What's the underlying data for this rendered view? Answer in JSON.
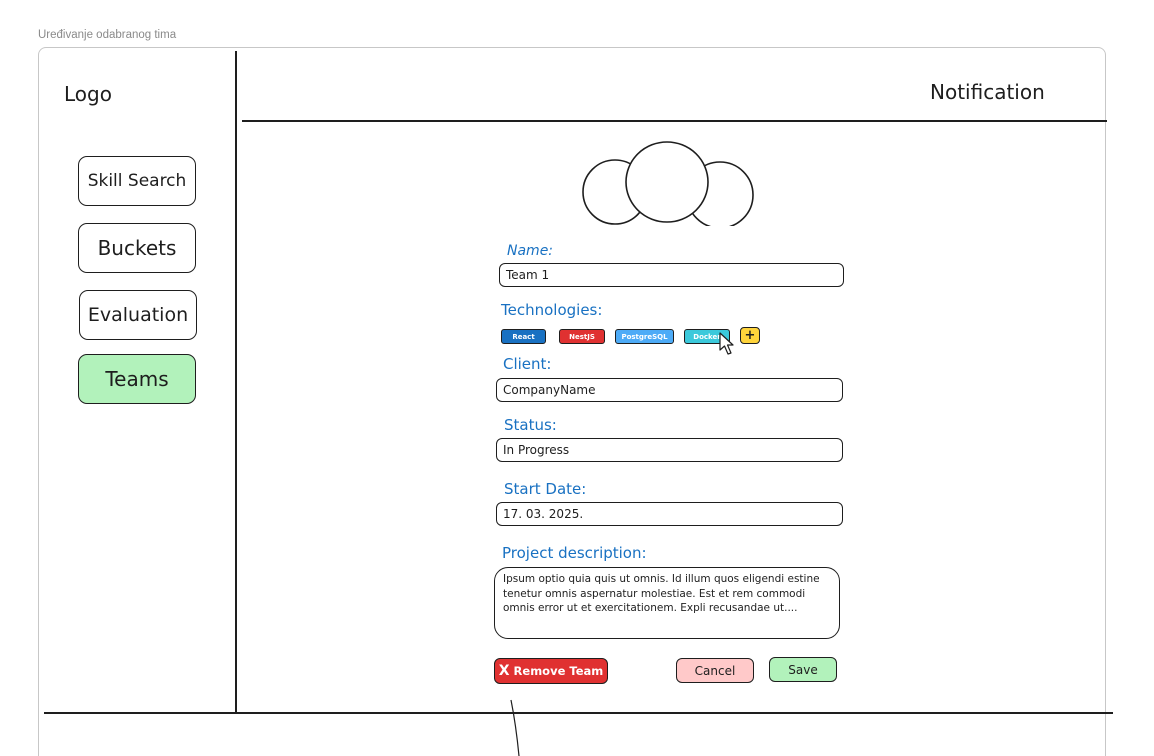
{
  "frame": {
    "title": "Uređivanje odabranog tima"
  },
  "header": {
    "logo": "Logo",
    "notification": "Notification"
  },
  "sidebar": {
    "items": [
      {
        "label": "Skill Search",
        "active": false
      },
      {
        "label": "Buckets",
        "active": false
      },
      {
        "label": "Evaluation",
        "active": false
      },
      {
        "label": "Teams",
        "active": true
      }
    ]
  },
  "form": {
    "name": {
      "label": "Name:",
      "value": "Team 1"
    },
    "technologies": {
      "label": "Technologies:",
      "items": [
        {
          "label": "React",
          "color": "#1971c2"
        },
        {
          "label": "NestJS",
          "color": "#e03131"
        },
        {
          "label": "PostgreSQL",
          "color": "#4dabf7"
        },
        {
          "label": "Docker",
          "color": "#3bc9db"
        }
      ],
      "add_label": "+"
    },
    "client": {
      "label": "Client:",
      "value": "CompanyName"
    },
    "status": {
      "label": "Status:",
      "value": "In Progress"
    },
    "start_date": {
      "label": "Start Date:",
      "value": "17. 03. 2025."
    },
    "description": {
      "label": "Project description:",
      "value": "Ipsum optio quia quis ut omnis. Id illum quos eligendi estine tenetur omnis aspernatur molestiae. Est et rem commodi omnis error ut et exercitationem. Expli recusandae ut...."
    }
  },
  "actions": {
    "remove_icon": "X",
    "remove_label": "Remove Team",
    "cancel_label": "Cancel",
    "save_label": "Save"
  },
  "colors": {
    "accent_blue": "#1971c2",
    "active_green": "#b2f2bb",
    "danger_red": "#e03131",
    "cancel_pink": "#ffc9c9",
    "add_yellow": "#ffd43b"
  }
}
